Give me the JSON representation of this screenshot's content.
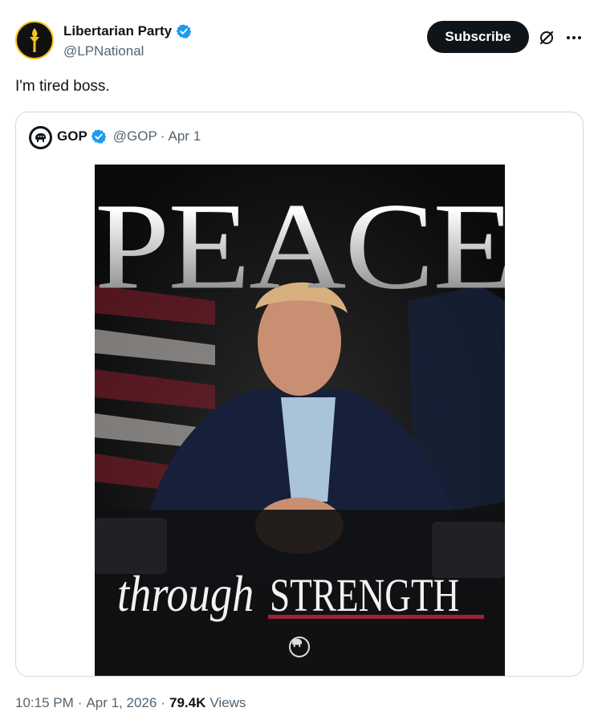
{
  "author": {
    "display_name": "Libertarian Party",
    "handle": "@LPNational",
    "avatar_icon": "torch-icon",
    "verified_icon": "verified-badge-icon"
  },
  "header_actions": {
    "subscribe_label": "Subscribe",
    "grok_icon": "grok-icon",
    "more_icon": "more-icon"
  },
  "tweet": {
    "text": "I'm tired boss."
  },
  "quoted": {
    "display_name": "GOP",
    "handle": "@GOP",
    "separator": "·",
    "date": "Apr 1",
    "avatar_icon": "elephant-icon",
    "verified_icon": "verified-badge-icon",
    "image": {
      "headline": "PEACE",
      "sub_italic": "through",
      "sub_caps": "STRENGTH",
      "accent_color": "#9b2335",
      "description_icon": "gop-elephant-logo-icon"
    }
  },
  "meta": {
    "time": "10:15 PM",
    "separator": "·",
    "date": "Apr 1, 2026",
    "views_count": "79.4K",
    "views_label": "Views"
  },
  "colors": {
    "verified_blue": "#1d9bf0",
    "secondary_text": "#536471",
    "primary_text": "#0f1419",
    "border": "#cfd9de"
  }
}
